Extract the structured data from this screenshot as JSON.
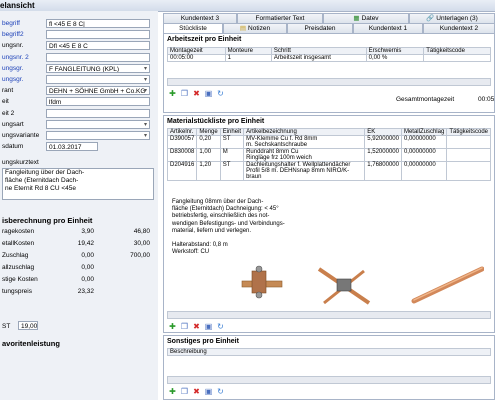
{
  "header": {
    "title": "elansicht"
  },
  "left": {
    "fields": [
      {
        "label": "begriff",
        "value": "fl <45 E 8 C|"
      },
      {
        "label": "begriff2",
        "value": ""
      },
      {
        "label": "ungsnr.",
        "value": "Dfl <45 E 8 C"
      },
      {
        "label": "ungsnr. 2",
        "value": ""
      },
      {
        "label": "ungsgr.",
        "value": "F FANGLEITUNG (KPL)"
      },
      {
        "label": "ungsgr.",
        "value": ""
      },
      {
        "label": "rant",
        "value": "DEHN + SÖHNE GmbH + Co.KG"
      },
      {
        "label": "eit",
        "value": "lfdm"
      },
      {
        "label": "eit 2",
        "value": ""
      },
      {
        "label": "ungsart",
        "value": ""
      },
      {
        "label": "ungsvariante",
        "value": ""
      },
      {
        "label": "sdatum",
        "value": "01.03.2017"
      }
    ],
    "kurztext_label": "ungskurztext",
    "kurztext": "Fangleitung über der Dach-\nfläche (Eternitdach Dach-\nne Eternit Rd 8 CU <45e",
    "calc_title": "isberechnung pro Einheit",
    "calc_rows": [
      {
        "label": "ragekosten",
        "v1": "3,90",
        "v2": "46,80"
      },
      {
        "label": "etallKosten",
        "v1": "19,42",
        "v2": "30,00"
      },
      {
        "label": "Zuschlag",
        "v1": "0,00",
        "v2": "700,00"
      },
      {
        "label": "allzuschlag",
        "v1": "0,00",
        "v2": ""
      },
      {
        "label": "stige Kosten",
        "v1": "0,00",
        "v2": ""
      },
      {
        "label": "tungspreis",
        "v1": "23,32",
        "v2": ""
      }
    ],
    "mwst_label": "ST",
    "mwst_value": "19,00",
    "favorites": "avoritenleistung"
  },
  "tabs_row1": [
    {
      "label": "Kundentext 3",
      "icon": ""
    },
    {
      "label": "Formatierter Text",
      "icon": ""
    },
    {
      "label": "Datev",
      "icon": "datev-icon"
    },
    {
      "label": "Unterlagen (3)",
      "icon": "paperclip-icon"
    }
  ],
  "tabs_row2": [
    {
      "label": "Stückliste",
      "icon": ""
    },
    {
      "label": "Notizen",
      "icon": "notes-icon"
    },
    {
      "label": "Preisdaten",
      "icon": ""
    },
    {
      "label": "Kundentext 1",
      "icon": ""
    },
    {
      "label": "Kundentext 2",
      "icon": ""
    }
  ],
  "arbeitszeit": {
    "title": "Arbeitszeit pro Einheit",
    "columns": [
      "Montagezeit",
      "Monteure",
      "Schritt",
      "Erschwernis",
      "Tätigkeitscode"
    ],
    "rows": [
      [
        "00:05:00",
        "1",
        "Arbeitszeit insgesamt",
        "0,00 %",
        ""
      ]
    ],
    "gesamt_label": "Gesamtmontagezeit",
    "gesamt_value": "00:05"
  },
  "material": {
    "title": "Materialstückliste pro Einheit",
    "columns": [
      "Artikelnr.",
      "Menge",
      "Einheit",
      "Artikelbezeichnung",
      "EK",
      "MetallZuschlag",
      "Tätigkeitscode"
    ],
    "rows": [
      [
        "D390057",
        "0,20",
        "ST",
        "MV-Klemme Cu f. Rd 8mm\nm. Sechskantschraube",
        "5,92000000",
        "0,00000000",
        ""
      ],
      [
        "D830008",
        "1,00",
        "M",
        "Runddraht 8mm Cu\nRingläge frz 100m weich",
        "1,52000000",
        "0,00000000",
        ""
      ],
      [
        "D204916",
        "1,20",
        "ST",
        "Dachleitungshalter f. Wellplattendächer\nProfil 5/8 m. DEHNsnap 8mm NIRO/K-braun",
        "1,76800000",
        "0,00000000",
        ""
      ]
    ],
    "description": "Fangleitung 08mm über der Dach-\nfläche (Eternitdach) Dachneigung: < 45°\nbetriebsfertig, einschließlich des not-\nwendigen Befestigungs- und Verbindungs-\nmaterial, liefern und verlegen.\n\nHalterabstand: 0,8 m\nWerkstoff: CU"
  },
  "sonstiges": {
    "title": "Sonstiges pro Einheit",
    "columns": [
      "Beschreibung"
    ]
  }
}
